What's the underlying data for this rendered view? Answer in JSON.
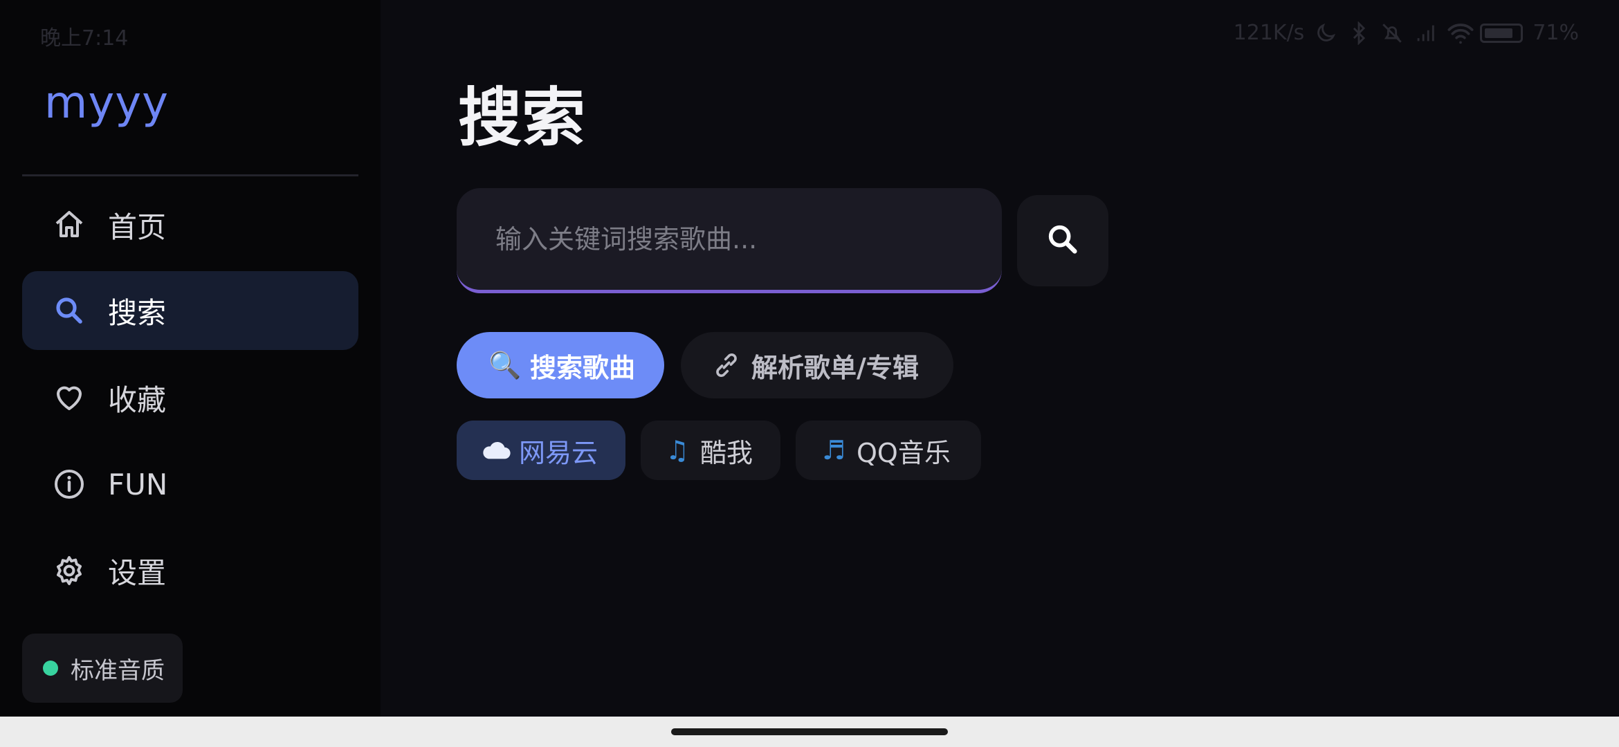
{
  "status_bar": {
    "time": "晚上7:14",
    "net_speed": "121K/s",
    "battery": "71%"
  },
  "sidebar": {
    "logo": "myyy",
    "items": [
      {
        "label": "首页",
        "icon": "home-icon",
        "active": false
      },
      {
        "label": "搜索",
        "icon": "search-icon",
        "active": true
      },
      {
        "label": "收藏",
        "icon": "heart-icon",
        "active": false
      },
      {
        "label": "FUN",
        "icon": "info-icon",
        "active": false
      },
      {
        "label": "设置",
        "icon": "gear-icon",
        "active": false
      }
    ],
    "quality": {
      "label": "标准音质",
      "dot_color": "#38d39f"
    }
  },
  "main": {
    "title": "搜索",
    "search": {
      "placeholder": "输入关键词搜索歌曲...",
      "value": ""
    },
    "modes": [
      {
        "label": "搜索歌曲",
        "icon": "magnifier-emoji-icon",
        "glyph": "🔍",
        "selected": true
      },
      {
        "label": "解析歌单/专辑",
        "icon": "link-icon",
        "glyph": "🔗",
        "selected": false
      }
    ],
    "sources": [
      {
        "label": "网易云",
        "icon": "cloud-icon",
        "glyph": "☁",
        "selected": true
      },
      {
        "label": "酷我",
        "icon": "music-note-icon",
        "glyph": "♫",
        "selected": false
      },
      {
        "label": "QQ音乐",
        "icon": "music-notes-icon",
        "glyph": "♬",
        "selected": false
      }
    ]
  },
  "colors": {
    "accent": "#6d8cf7",
    "logo": "#6e86f5",
    "search_underline": "#7a5fd2",
    "active_nav_bg": "#161d30",
    "background": "#0b0b10"
  }
}
